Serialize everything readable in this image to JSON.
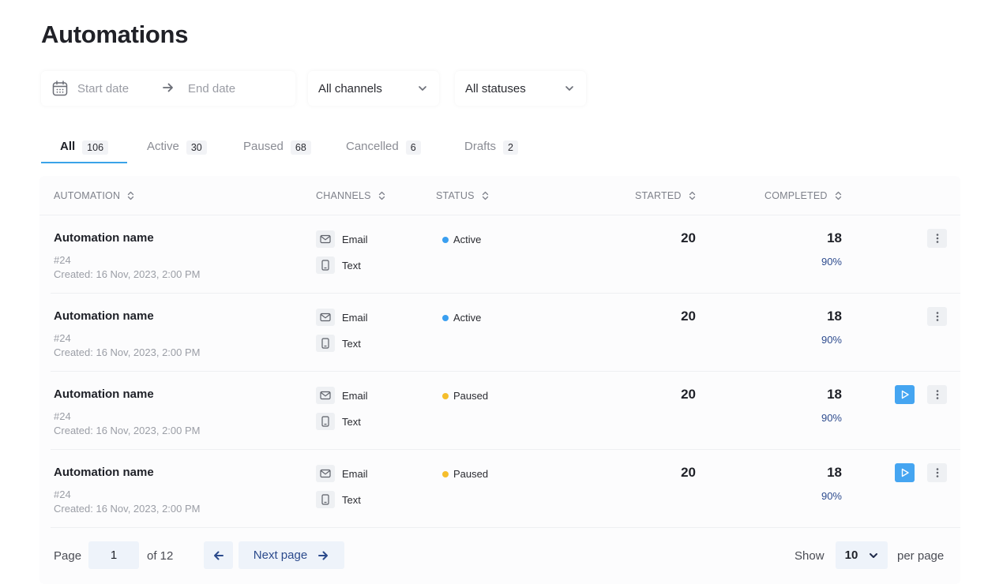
{
  "page": {
    "title": "Automations"
  },
  "filters": {
    "start_date_placeholder": "Start date",
    "end_date_placeholder": "End date",
    "channel_selected": "All channels",
    "status_selected": "All statuses"
  },
  "tabs": [
    {
      "label": "All",
      "count": "106",
      "active": true
    },
    {
      "label": "Active",
      "count": "30",
      "active": false
    },
    {
      "label": "Paused",
      "count": "68",
      "active": false
    },
    {
      "label": "Cancelled",
      "count": "6",
      "active": false
    },
    {
      "label": "Drafts",
      "count": "2",
      "active": false
    }
  ],
  "table": {
    "columns": [
      "AUTOMATION",
      "CHANNELS",
      "STATUS",
      "STARTED",
      "COMPLETED"
    ],
    "rows": [
      {
        "name": "Automation name",
        "id": "#24",
        "created": "Created: 16 Nov, 2023, 2:00 PM",
        "channels": [
          "Email",
          "Text"
        ],
        "status": "Active",
        "status_color": "#3a9ff0",
        "started": "20",
        "completed": "18",
        "completed_pct": "90%",
        "has_play": false
      },
      {
        "name": "Automation name",
        "id": "#24",
        "created": "Created: 16 Nov, 2023, 2:00 PM",
        "channels": [
          "Email",
          "Text"
        ],
        "status": "Active",
        "status_color": "#3a9ff0",
        "started": "20",
        "completed": "18",
        "completed_pct": "90%",
        "has_play": false
      },
      {
        "name": "Automation name",
        "id": "#24",
        "created": "Created: 16 Nov, 2023, 2:00 PM",
        "channels": [
          "Email",
          "Text"
        ],
        "status": "Paused",
        "status_color": "#f5be2c",
        "started": "20",
        "completed": "18",
        "completed_pct": "90%",
        "has_play": true
      },
      {
        "name": "Automation name",
        "id": "#24",
        "created": "Created: 16 Nov, 2023, 2:00 PM",
        "channels": [
          "Email",
          "Text"
        ],
        "status": "Paused",
        "status_color": "#f5be2c",
        "started": "20",
        "completed": "18",
        "completed_pct": "90%",
        "has_play": true
      }
    ]
  },
  "pagination": {
    "page_label": "Page",
    "current_page": "1",
    "of_label": "of 12",
    "next_label": "Next page",
    "show_label": "Show",
    "page_size": "10",
    "per_page_label": "per page"
  },
  "icons": {
    "calendar": "calendar-icon",
    "arrow": "arrow-right-icon",
    "chevron": "chevron-down-icon",
    "sort": "sort-icon",
    "email": "mail-icon",
    "text": "phone-icon",
    "play": "play-icon",
    "more": "more-vertical-icon",
    "prev": "arrow-left-icon"
  },
  "colors": {
    "accent": "#3aa3e8",
    "play_button": "#45a5f1",
    "link": "#2e4c8f"
  }
}
